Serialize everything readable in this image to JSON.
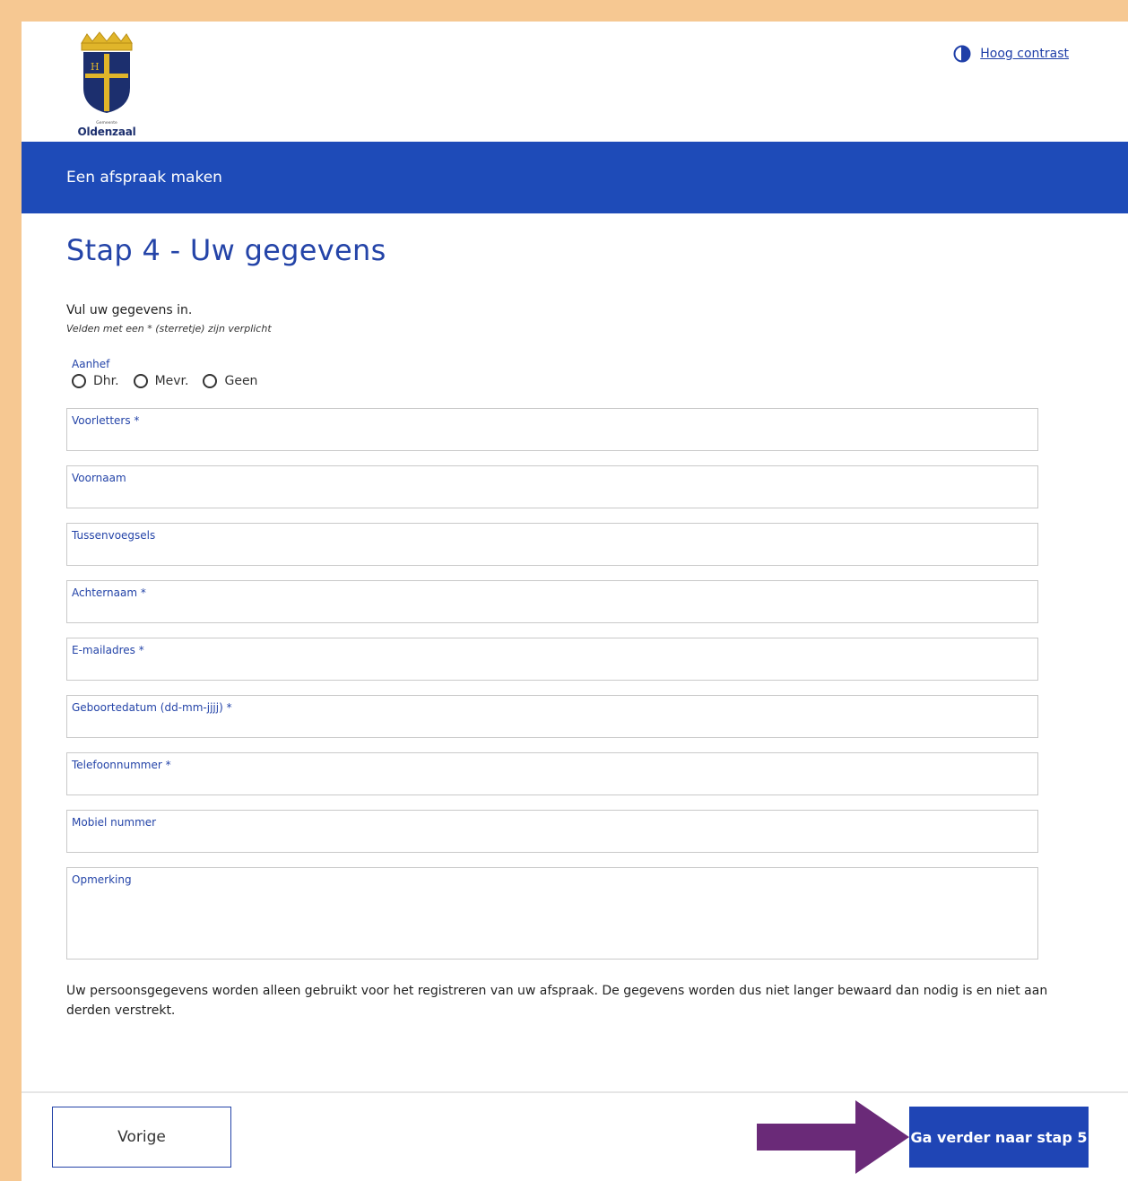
{
  "header": {
    "logo_sub": "Gemeente",
    "logo_name": "Oldenzaal",
    "contrast_link": "Hoog contrast"
  },
  "banner": {
    "title": "Een afspraak maken"
  },
  "main": {
    "title": "Stap 4 - Uw gegevens",
    "intro": "Vul uw gegevens in.",
    "required_note": "Velden met een * (sterretje) zijn verplicht",
    "salutation": {
      "label": "Aanhef",
      "options": [
        "Dhr.",
        "Mevr.",
        "Geen"
      ]
    },
    "fields": [
      "Voorletters *",
      "Voornaam",
      "Tussenvoegsels",
      "Achternaam *",
      "E-mailadres *",
      "Geboortedatum (dd-mm-jjjj) *",
      "Telefoonnummer *",
      "Mobiel nummer",
      "Opmerking"
    ],
    "privacy": "Uw persoonsgegevens worden alleen gebruikt voor het registreren van uw afspraak. De gegevens worden dus niet langer bewaard dan nodig is en niet aan derden verstrekt."
  },
  "footer": {
    "prev_label": "Vorige",
    "next_label": "Ga verder naar stap 5"
  },
  "colors": {
    "accent": "#1e4bb8",
    "page_border": "#f6c892",
    "annotation_arrow": "#6a2a78"
  }
}
